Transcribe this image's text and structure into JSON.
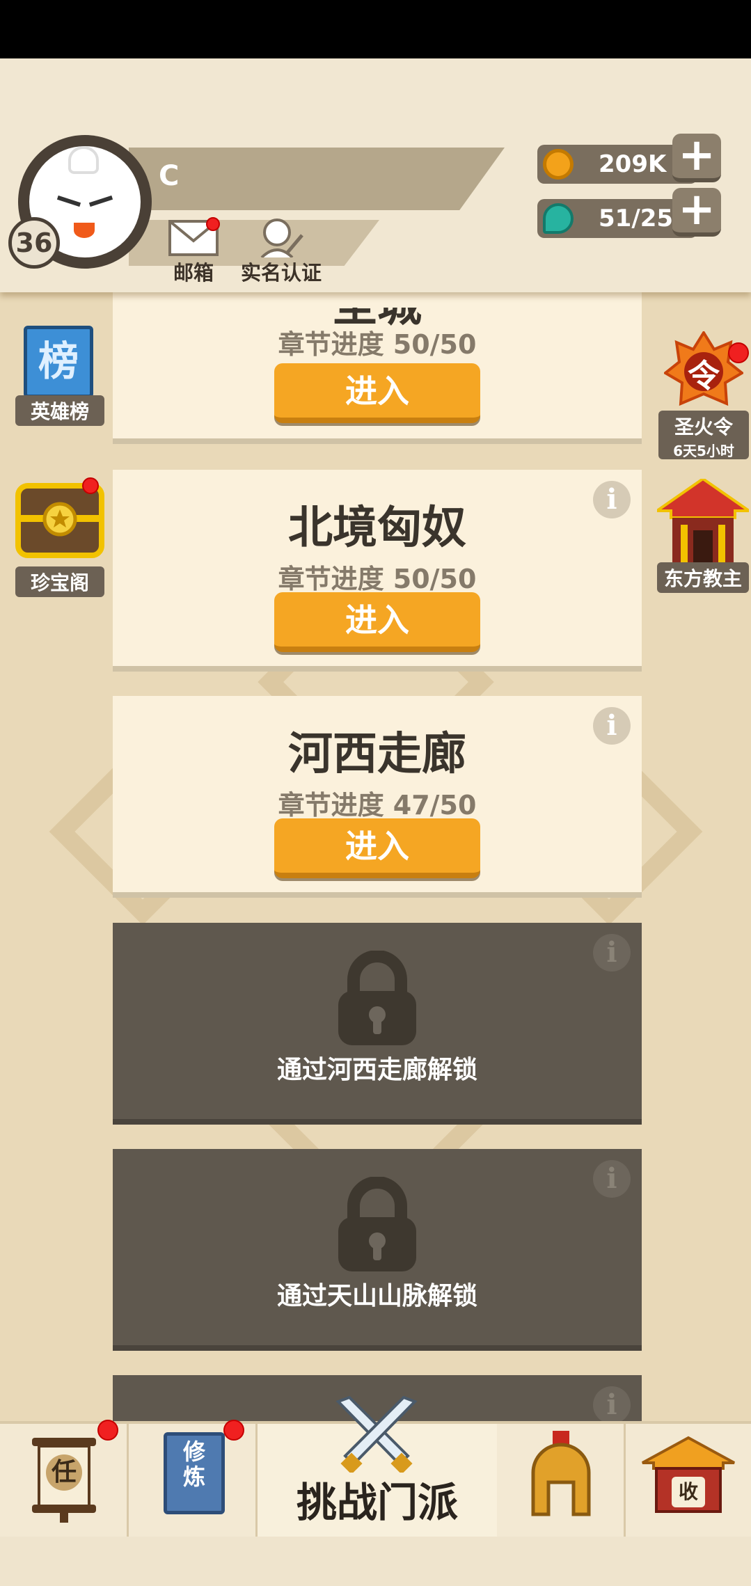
{
  "player": {
    "name": "C",
    "level": "36"
  },
  "header_buttons": {
    "mailbox_label": "邮箱",
    "verify_label": "实名认证"
  },
  "resources": {
    "coins": "209K",
    "energy": "51/25"
  },
  "left_side": {
    "ranking_icon_char": "榜",
    "ranking_label": "英雄榜",
    "treasure_label": "珍宝阁"
  },
  "right_side": {
    "holy_fire_icon_char": "令",
    "holy_fire_label": "圣火令",
    "holy_fire_timer": "6天5小时",
    "east_leader_label": "东方教主"
  },
  "chapters": [
    {
      "title": "圣城",
      "progress": "章节进度 50/50",
      "button": "进入"
    },
    {
      "title": "北境匈奴",
      "progress": "章节进度 50/50",
      "button": "进入"
    },
    {
      "title": "河西走廊",
      "progress": "章节进度 47/50",
      "button": "进入"
    }
  ],
  "locked_chapters": [
    {
      "text": "通过河西走廊解锁"
    },
    {
      "text": "通过天山山脉解锁"
    }
  ],
  "info_symbol": "i",
  "plus_symbol": "+",
  "bottom_nav": {
    "task_char": "任",
    "cultivate_chars": "修炼",
    "challenge_label": "挑战门派",
    "collect_char": "收"
  },
  "colors": {
    "enter_button": "#f5a623",
    "locked_card": "#5f584e",
    "card_bg": "#fbf1dc",
    "red_dot": "#f02020"
  }
}
